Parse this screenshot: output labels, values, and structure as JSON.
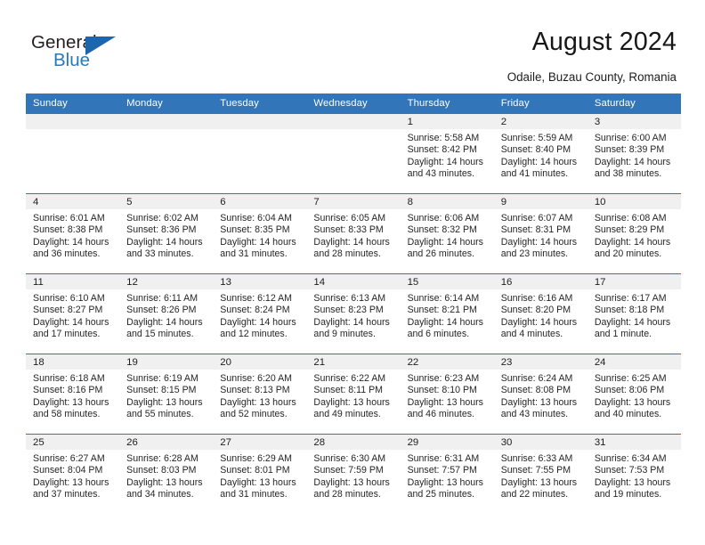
{
  "logo": {
    "word1": "General",
    "word2": "Blue",
    "triangle_color": "#1b66ad",
    "blue_color": "#2679bd"
  },
  "header": {
    "title": "August 2024",
    "subtitle": "Odaile, Buzau County, Romania"
  },
  "theme": {
    "header_blue": "#3275b8",
    "daynum_band": "#f0f0f0",
    "text": "#262626"
  },
  "calendar": {
    "weekday_headers": [
      "Sunday",
      "Monday",
      "Tuesday",
      "Wednesday",
      "Thursday",
      "Friday",
      "Saturday"
    ],
    "weeks": [
      [
        {
          "day": "",
          "empty": true
        },
        {
          "day": "",
          "empty": true
        },
        {
          "day": "",
          "empty": true
        },
        {
          "day": "",
          "empty": true
        },
        {
          "day": "1",
          "sunrise": "Sunrise: 5:58 AM",
          "sunset": "Sunset: 8:42 PM",
          "daylight1": "Daylight: 14 hours",
          "daylight2": "and 43 minutes."
        },
        {
          "day": "2",
          "sunrise": "Sunrise: 5:59 AM",
          "sunset": "Sunset: 8:40 PM",
          "daylight1": "Daylight: 14 hours",
          "daylight2": "and 41 minutes."
        },
        {
          "day": "3",
          "sunrise": "Sunrise: 6:00 AM",
          "sunset": "Sunset: 8:39 PM",
          "daylight1": "Daylight: 14 hours",
          "daylight2": "and 38 minutes."
        }
      ],
      [
        {
          "day": "4",
          "sunrise": "Sunrise: 6:01 AM",
          "sunset": "Sunset: 8:38 PM",
          "daylight1": "Daylight: 14 hours",
          "daylight2": "and 36 minutes."
        },
        {
          "day": "5",
          "sunrise": "Sunrise: 6:02 AM",
          "sunset": "Sunset: 8:36 PM",
          "daylight1": "Daylight: 14 hours",
          "daylight2": "and 33 minutes."
        },
        {
          "day": "6",
          "sunrise": "Sunrise: 6:04 AM",
          "sunset": "Sunset: 8:35 PM",
          "daylight1": "Daylight: 14 hours",
          "daylight2": "and 31 minutes."
        },
        {
          "day": "7",
          "sunrise": "Sunrise: 6:05 AM",
          "sunset": "Sunset: 8:33 PM",
          "daylight1": "Daylight: 14 hours",
          "daylight2": "and 28 minutes."
        },
        {
          "day": "8",
          "sunrise": "Sunrise: 6:06 AM",
          "sunset": "Sunset: 8:32 PM",
          "daylight1": "Daylight: 14 hours",
          "daylight2": "and 26 minutes."
        },
        {
          "day": "9",
          "sunrise": "Sunrise: 6:07 AM",
          "sunset": "Sunset: 8:31 PM",
          "daylight1": "Daylight: 14 hours",
          "daylight2": "and 23 minutes."
        },
        {
          "day": "10",
          "sunrise": "Sunrise: 6:08 AM",
          "sunset": "Sunset: 8:29 PM",
          "daylight1": "Daylight: 14 hours",
          "daylight2": "and 20 minutes."
        }
      ],
      [
        {
          "day": "11",
          "sunrise": "Sunrise: 6:10 AM",
          "sunset": "Sunset: 8:27 PM",
          "daylight1": "Daylight: 14 hours",
          "daylight2": "and 17 minutes."
        },
        {
          "day": "12",
          "sunrise": "Sunrise: 6:11 AM",
          "sunset": "Sunset: 8:26 PM",
          "daylight1": "Daylight: 14 hours",
          "daylight2": "and 15 minutes."
        },
        {
          "day": "13",
          "sunrise": "Sunrise: 6:12 AM",
          "sunset": "Sunset: 8:24 PM",
          "daylight1": "Daylight: 14 hours",
          "daylight2": "and 12 minutes."
        },
        {
          "day": "14",
          "sunrise": "Sunrise: 6:13 AM",
          "sunset": "Sunset: 8:23 PM",
          "daylight1": "Daylight: 14 hours",
          "daylight2": "and 9 minutes."
        },
        {
          "day": "15",
          "sunrise": "Sunrise: 6:14 AM",
          "sunset": "Sunset: 8:21 PM",
          "daylight1": "Daylight: 14 hours",
          "daylight2": "and 6 minutes."
        },
        {
          "day": "16",
          "sunrise": "Sunrise: 6:16 AM",
          "sunset": "Sunset: 8:20 PM",
          "daylight1": "Daylight: 14 hours",
          "daylight2": "and 4 minutes."
        },
        {
          "day": "17",
          "sunrise": "Sunrise: 6:17 AM",
          "sunset": "Sunset: 8:18 PM",
          "daylight1": "Daylight: 14 hours",
          "daylight2": "and 1 minute."
        }
      ],
      [
        {
          "day": "18",
          "sunrise": "Sunrise: 6:18 AM",
          "sunset": "Sunset: 8:16 PM",
          "daylight1": "Daylight: 13 hours",
          "daylight2": "and 58 minutes."
        },
        {
          "day": "19",
          "sunrise": "Sunrise: 6:19 AM",
          "sunset": "Sunset: 8:15 PM",
          "daylight1": "Daylight: 13 hours",
          "daylight2": "and 55 minutes."
        },
        {
          "day": "20",
          "sunrise": "Sunrise: 6:20 AM",
          "sunset": "Sunset: 8:13 PM",
          "daylight1": "Daylight: 13 hours",
          "daylight2": "and 52 minutes."
        },
        {
          "day": "21",
          "sunrise": "Sunrise: 6:22 AM",
          "sunset": "Sunset: 8:11 PM",
          "daylight1": "Daylight: 13 hours",
          "daylight2": "and 49 minutes."
        },
        {
          "day": "22",
          "sunrise": "Sunrise: 6:23 AM",
          "sunset": "Sunset: 8:10 PM",
          "daylight1": "Daylight: 13 hours",
          "daylight2": "and 46 minutes."
        },
        {
          "day": "23",
          "sunrise": "Sunrise: 6:24 AM",
          "sunset": "Sunset: 8:08 PM",
          "daylight1": "Daylight: 13 hours",
          "daylight2": "and 43 minutes."
        },
        {
          "day": "24",
          "sunrise": "Sunrise: 6:25 AM",
          "sunset": "Sunset: 8:06 PM",
          "daylight1": "Daylight: 13 hours",
          "daylight2": "and 40 minutes."
        }
      ],
      [
        {
          "day": "25",
          "sunrise": "Sunrise: 6:27 AM",
          "sunset": "Sunset: 8:04 PM",
          "daylight1": "Daylight: 13 hours",
          "daylight2": "and 37 minutes."
        },
        {
          "day": "26",
          "sunrise": "Sunrise: 6:28 AM",
          "sunset": "Sunset: 8:03 PM",
          "daylight1": "Daylight: 13 hours",
          "daylight2": "and 34 minutes."
        },
        {
          "day": "27",
          "sunrise": "Sunrise: 6:29 AM",
          "sunset": "Sunset: 8:01 PM",
          "daylight1": "Daylight: 13 hours",
          "daylight2": "and 31 minutes."
        },
        {
          "day": "28",
          "sunrise": "Sunrise: 6:30 AM",
          "sunset": "Sunset: 7:59 PM",
          "daylight1": "Daylight: 13 hours",
          "daylight2": "and 28 minutes."
        },
        {
          "day": "29",
          "sunrise": "Sunrise: 6:31 AM",
          "sunset": "Sunset: 7:57 PM",
          "daylight1": "Daylight: 13 hours",
          "daylight2": "and 25 minutes."
        },
        {
          "day": "30",
          "sunrise": "Sunrise: 6:33 AM",
          "sunset": "Sunset: 7:55 PM",
          "daylight1": "Daylight: 13 hours",
          "daylight2": "and 22 minutes."
        },
        {
          "day": "31",
          "sunrise": "Sunrise: 6:34 AM",
          "sunset": "Sunset: 7:53 PM",
          "daylight1": "Daylight: 13 hours",
          "daylight2": "and 19 minutes."
        }
      ]
    ]
  }
}
